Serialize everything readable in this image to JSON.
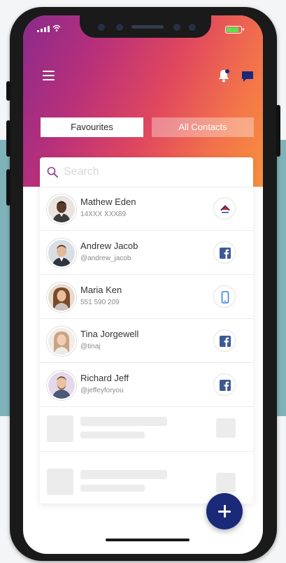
{
  "tabs": {
    "favourites": "Favourites",
    "all_contacts": "All Contacts"
  },
  "search": {
    "placeholder": "Search"
  },
  "contacts": [
    {
      "name": "Mathew Eden",
      "detail": "14XXX XXX89",
      "source_icon": "bank-logo-icon"
    },
    {
      "name": "Andrew Jacob",
      "detail": "@andrew_jacob",
      "source_icon": "facebook-icon"
    },
    {
      "name": "Maria Ken",
      "detail": "551 590 209",
      "source_icon": "phone-icon"
    },
    {
      "name": "Tina Jorgewell",
      "detail": "@tinaj",
      "source_icon": "facebook-icon"
    },
    {
      "name": "Richard Jeff",
      "detail": "@jeffeyforyou",
      "source_icon": "facebook-icon"
    }
  ],
  "colors": {
    "gradient_start": "#8a2a8c",
    "gradient_end": "#f7913f",
    "fab": "#1a2a78",
    "facebook": "#3b5998",
    "teal_background": "#7fb3b9"
  },
  "icons": {
    "menu": "menu-icon",
    "notifications": "bell-icon",
    "messages": "chat-icon",
    "search": "search-icon",
    "add": "plus-icon"
  }
}
